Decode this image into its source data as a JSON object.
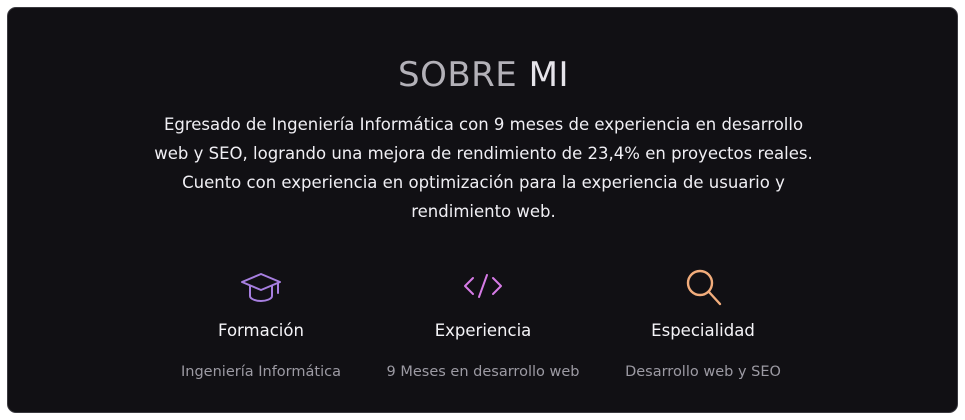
{
  "about": {
    "title_part1": "SOBRE",
    "title_part2": "MI",
    "description": "Egresado de Ingeniería Informática con 9 meses de experiencia en desarrollo web y SEO, logrando una mejora de rendimiento de 23,4% en proyectos reales. Cuento con experiencia en optimización para la experiencia de usuario y rendimiento web."
  },
  "features": [
    {
      "icon": "graduation-cap-icon",
      "title": "Formación",
      "description": "Ingeniería Informática"
    },
    {
      "icon": "code-icon",
      "title": "Experiencia",
      "description": "9 Meses en desarrollo web"
    },
    {
      "icon": "search-icon",
      "title": "Especialidad",
      "description": "Desarrollo web y SEO"
    }
  ],
  "colors": {
    "background": "#111014",
    "border": "#3a393f",
    "icon_purple": "#a77fe0",
    "icon_pink": "#d67be6",
    "icon_orange": "#f2ad7c"
  }
}
